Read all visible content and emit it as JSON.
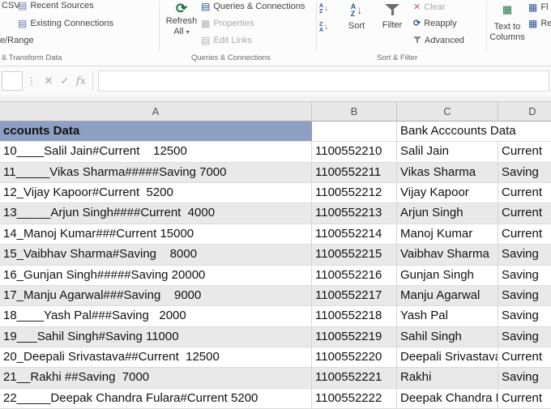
{
  "ribbon": {
    "left": {
      "csv_partial": "CSV",
      "recent_sources": "Recent Sources",
      "existing_connections": "Existing Connections",
      "range_partial": "e/Range",
      "group_label": "& Transform Data"
    },
    "queries": {
      "refresh_line1": "Refresh",
      "refresh_line2": "All",
      "queries_connections": "Queries & Connections",
      "properties": "Properties",
      "edit_links": "Edit Links",
      "group_label": "Queries & Connections"
    },
    "sort_filter": {
      "sort_label": "Sort",
      "filter_label": "Filter",
      "clear_label": "Clear",
      "reapply_label": "Reapply",
      "advanced_label": "Advanced",
      "group_label": "Sort & Filter",
      "letter_a": "A",
      "letter_z": "Z"
    },
    "data_tools": {
      "text_to_columns_line1": "Text to",
      "text_to_columns_line2": "Columns",
      "flash_fill_partial": "Fl",
      "remove_duplicates_partial": "Re"
    }
  },
  "icons": {
    "dropdown": "▾",
    "cancel": "✕",
    "check": "✓",
    "refresh": "⟳",
    "sheet": "▤",
    "grid": "▦",
    "arrow_down": "↓",
    "dots": "⋮"
  },
  "formula_bar": {
    "cancel": "✕",
    "enter": "✓",
    "fx": "fx",
    "value": ""
  },
  "sheet": {
    "columns": [
      "A",
      "B",
      "C",
      "D"
    ],
    "title_row": {
      "a": "ccounts Data",
      "b": "",
      "c": "Bank Acccounts Data",
      "d": ""
    },
    "rows": [
      {
        "a": "10____Salil Jain#Current    12500",
        "b": "1100552210",
        "c": "Salil Jain",
        "d": "Current"
      },
      {
        "a": "11_____Vikas Sharma#####Saving 7000",
        "b": "1100552211",
        "c": "Vikas Sharma",
        "d": "Saving"
      },
      {
        "a": "12_Vijay Kapoor#Current  5200",
        "b": "1100552212",
        "c": "Vijay Kapoor",
        "d": "Current"
      },
      {
        "a": "13_____Arjun Singh####Current  4000",
        "b": "1100552213",
        "c": "Arjun Singh",
        "d": "Current"
      },
      {
        "a": "14_Manoj Kumar###Current 15000",
        "b": "1100552214",
        "c": "Manoj Kumar",
        "d": "Current"
      },
      {
        "a": "15_Vaibhav Sharma#Saving    8000",
        "b": "1100552215",
        "c": "Vaibhav Sharma",
        "d": "Saving"
      },
      {
        "a": "16_Gunjan Singh#####Saving 20000",
        "b": "1100552216",
        "c": "Gunjan Singh",
        "d": "Saving"
      },
      {
        "a": "17_Manju Agarwal###Saving    9000",
        "b": "1100552217",
        "c": "Manju Agarwal",
        "d": "Saving"
      },
      {
        "a": "18____Yash Pal###Saving   2000",
        "b": "1100552218",
        "c": "Yash Pal",
        "d": "Saving"
      },
      {
        "a": "19___Sahil Singh#Saving 11000",
        "b": "1100552219",
        "c": "Sahil Singh",
        "d": "Saving"
      },
      {
        "a": "20_Deepali Srivastava##Current  12500",
        "b": "1100552220",
        "c": "Deepali Srivastava",
        "d": "Current"
      },
      {
        "a": "21__Rakhi ##Saving  7000",
        "b": "1100552221",
        "c": "Rakhi",
        "d": "Saving"
      },
      {
        "a": "22_____Deepak Chandra Fulara#Current 5200",
        "b": "1100552222",
        "c": "Deepak Chandra Fulara",
        "d": "Current"
      }
    ],
    "colors": {
      "title_fill": "#8d9fc2",
      "shaded_row": "#e9e9e9",
      "excel_green": "#217346",
      "accent_blue": "#2b579a"
    }
  }
}
